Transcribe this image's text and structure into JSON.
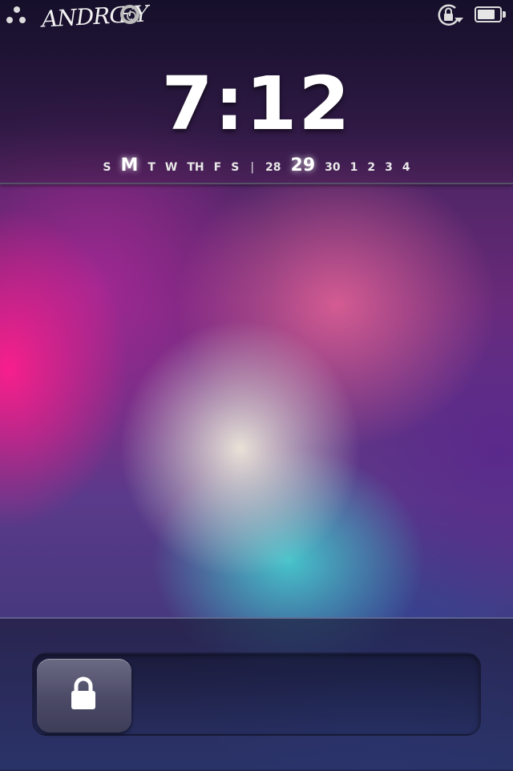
{
  "status_bar": {
    "carrier": "ANDRŒY",
    "icons": [
      "dots-icon",
      "ring-icon",
      "rotation-lock-icon",
      "battery-icon"
    ],
    "battery_level": 0.8
  },
  "lockscreen": {
    "time": "7:12",
    "weekdays": [
      "S",
      "M",
      "T",
      "W",
      "TH",
      "F",
      "S"
    ],
    "current_weekday_index": 1,
    "separator": "|",
    "dates": [
      "28",
      "29",
      "30",
      "1",
      "2",
      "3",
      "4"
    ],
    "current_date_index": 1,
    "unlock_icon": "lock-icon"
  },
  "colors": {
    "accent_pink": "#ff1e8c",
    "accent_teal": "#46d2d2"
  }
}
